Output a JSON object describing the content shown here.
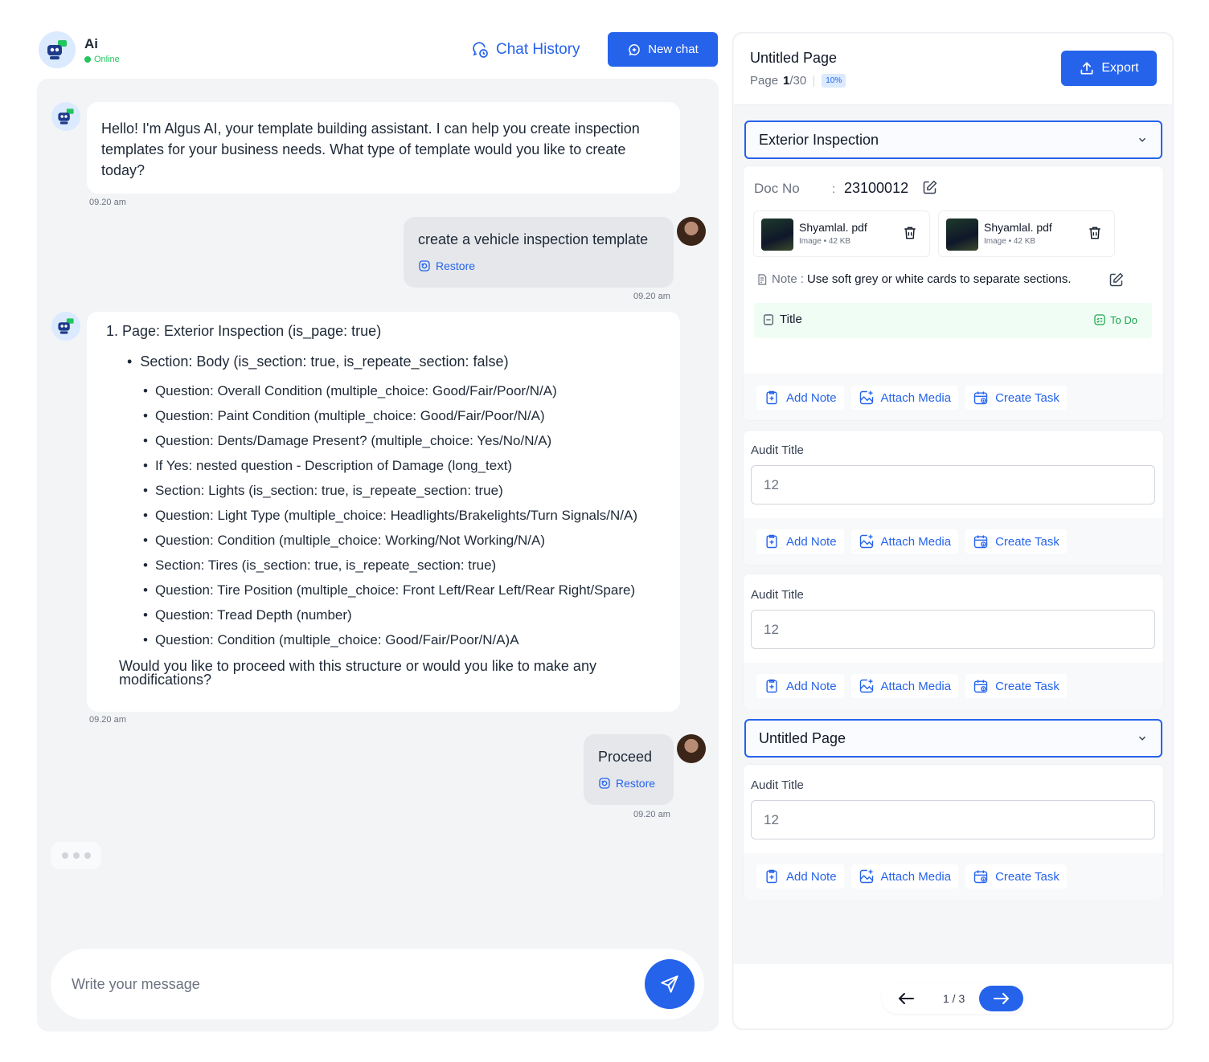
{
  "assistant": {
    "name": "Ai",
    "status": "Online"
  },
  "header": {
    "chat_history_label": "Chat History",
    "new_chat_label": "New chat"
  },
  "messages": {
    "m1": {
      "text": "Hello! I'm Algus AI, your template building assistant. I can help you create inspection templates for your business needs. What type of template would you like to create today?",
      "time": "09.20 am"
    },
    "m2": {
      "text": "create a vehicle inspection template",
      "restore": "Restore",
      "time": "09.20 am"
    },
    "m3": {
      "page_line": "1.  Page: Exterior Inspection (is_page: true)",
      "section_line": "Section: Body (is_section: true, is_repeate_section: false)",
      "items": [
        "Question: Overall Condition (multiple_choice: Good/Fair/Poor/N/A)",
        "Question: Paint Condition (multiple_choice: Good/Fair/Poor/N/A)",
        "Question: Dents/Damage Present? (multiple_choice: Yes/No/N/A)",
        "If Yes: nested question - Description of Damage (long_text)",
        "Section: Lights (is_section: true, is_repeate_section: true)",
        "Question: Light Type (multiple_choice: Headlights/Brakelights/Turn Signals/N/A)",
        "Question: Condition (multiple_choice: Working/Not Working/N/A)",
        "Section: Tires (is_section: true, is_repeate_section: true)",
        "Question: Tire Position (multiple_choice: Front Left/Rear Left/Rear Right/Spare)",
        "Question: Tread Depth (number)",
        "Question: Condition (multiple_choice: Good/Fair/Poor/N/A)A"
      ],
      "closing": "Would you like to proceed with this structure or would you like to make any modifications?",
      "time": "09.20 am"
    },
    "m4": {
      "text": "Proceed",
      "restore": "Restore",
      "time": "09.20 am"
    }
  },
  "composer": {
    "placeholder": "Write your message"
  },
  "panel": {
    "title": "Untitled Page",
    "page_label": "Page",
    "page_current": "1",
    "page_total": "/30",
    "percent": "10%",
    "export_label": "Export",
    "section1": "Exterior Inspection",
    "doc_label": "Doc No",
    "doc_colon": ":",
    "doc_value": "23100012",
    "files": [
      {
        "name": "Shyamlal. pdf",
        "meta": "Image • 42 KB"
      },
      {
        "name": "Shyamlal. pdf",
        "meta": "Image • 42 KB"
      }
    ],
    "note_label": "Note :",
    "note_text": "Use soft grey or white cards to separate sections.",
    "title_label": "Title",
    "todo_label": "To Do",
    "actions": {
      "add_note": "Add Note",
      "attach_media": "Attach Media",
      "create_task": "Create Task"
    },
    "audit_title": "Audit Title",
    "audit_value": "12",
    "section2": "Untitled Page",
    "pager": "1 / 3"
  },
  "colors": {
    "accent": "#2563eb",
    "online": "#22c55e",
    "todo": "#16a34a"
  }
}
